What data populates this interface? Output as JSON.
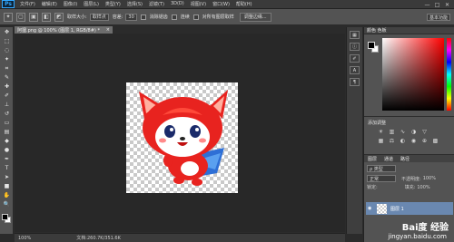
{
  "app": {
    "logo": "Ps"
  },
  "menu": [
    "文件(F)",
    "编辑(E)",
    "图像(I)",
    "图层(L)",
    "类型(Y)",
    "选择(S)",
    "滤镜(T)",
    "3D(D)",
    "视图(V)",
    "窗口(W)",
    "帮助(H)"
  ],
  "window_controls": [
    "—",
    "□",
    "✕"
  ],
  "options": {
    "sample_size_label": "取样大小:",
    "sample_size_value": "取样点",
    "tolerance_label": "容差:",
    "tolerance_value": "30",
    "antialias_label": "消除锯齿",
    "contiguous_label": "连续",
    "sample_all_label": "对所有图层取样",
    "refine_edge_button": "调整边缘...",
    "workspace": "基本功能"
  },
  "document": {
    "tab_title": "阿狸.png @ 100% (图层 1, RGB/8#) *",
    "close": "×"
  },
  "status": {
    "zoom": "100%",
    "doc_info": "文档:260.7K/351.6K"
  },
  "panels": {
    "color_tab": "颜色   色板",
    "adjustments_title": "添加调整",
    "layers_tabs": [
      "图层",
      "通道",
      "路径"
    ],
    "kind_select": "ρ 类型",
    "blend_mode": "正常",
    "opacity_label": "不透明度:",
    "opacity_value": "100%",
    "lock_label": "锁定:",
    "fill_label": "填充:",
    "fill_value": "100%",
    "layer_name": "图层 1"
  },
  "watermark": {
    "brand": "Bai度 经验",
    "url": "jingyan.baidu.com"
  },
  "colors": {
    "foreground": "#000000",
    "background": "#ffffff",
    "accent": "#31a8ff"
  }
}
